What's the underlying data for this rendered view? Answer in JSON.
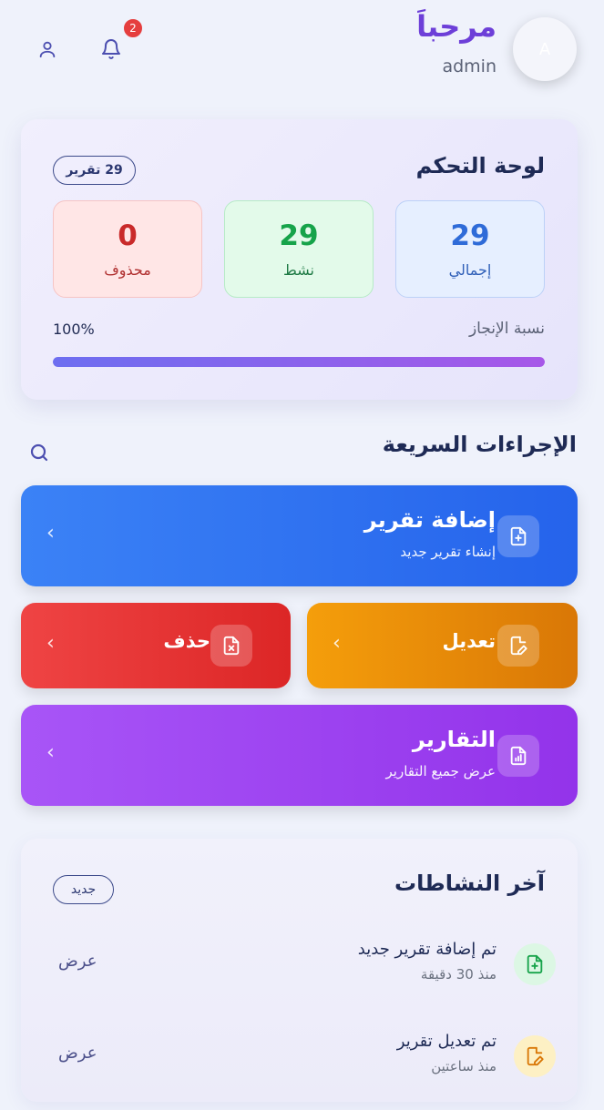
{
  "header": {
    "greeting": "مرحباَ",
    "username": "admin",
    "avatar_letter": "A",
    "notification_count": "2",
    "icons": [
      "bell-icon",
      "user-icon"
    ]
  },
  "dashboard": {
    "title": "لوحة التحكم",
    "report_count_label": "29 تقرير",
    "stats": [
      {
        "key": "total",
        "value": "29",
        "label": "إجمالي",
        "color": "#2f6bd8"
      },
      {
        "key": "active",
        "value": "29",
        "label": "نشط",
        "color": "#16a34a"
      },
      {
        "key": "deleted",
        "value": "0",
        "label": "محذوف",
        "color": "#c92a2a"
      }
    ],
    "progress_label": "نسبة الإنجاز",
    "progress_text": "100%",
    "progress_value": 1.0
  },
  "quick_actions": {
    "title": "الإجراءات السريعة",
    "items": [
      {
        "key": "add",
        "title": "إضافة تقرير",
        "subtitle": "إنشاء تقرير جديد",
        "icon": "file-plus-icon",
        "color": "#2563eb"
      },
      {
        "key": "edit",
        "title": "تعديل",
        "icon": "file-edit-icon",
        "color": "#d97706"
      },
      {
        "key": "delete",
        "title": "حذف",
        "icon": "file-x-icon",
        "color": "#dc2626"
      },
      {
        "key": "reports",
        "title": "التقارير",
        "subtitle": "عرض جميع التقارير",
        "icon": "file-chart-icon",
        "color": "#9333ea"
      }
    ]
  },
  "activity": {
    "title": "آخر النشاطات",
    "badge": "جديد",
    "items": [
      {
        "title": "تم إضافة تقرير جديد",
        "time": "منذ 30 دقيقة",
        "action": "عرض",
        "icon": "file-plus-icon",
        "color": "#16a34a"
      },
      {
        "title": "تم تعديل تقرير",
        "time": "منذ ساعتين",
        "action": "عرض",
        "icon": "file-edit-icon",
        "color": "#d97706"
      }
    ]
  }
}
